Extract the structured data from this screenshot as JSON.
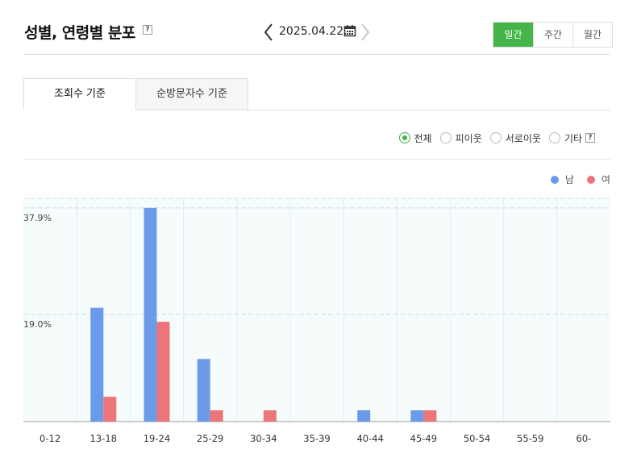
{
  "header": {
    "title": "성별, 연령별 분포",
    "help": "?",
    "date": "2025.04.22.",
    "periods": [
      {
        "label": "일간",
        "active": true
      },
      {
        "label": "주간",
        "active": false
      },
      {
        "label": "월간",
        "active": false
      }
    ]
  },
  "tabs": [
    {
      "label": "조회수 기준",
      "active": true
    },
    {
      "label": "순방문자수 기준",
      "active": false
    }
  ],
  "filters": {
    "options": [
      {
        "label": "전체",
        "selected": true
      },
      {
        "label": "피이웃",
        "selected": false
      },
      {
        "label": "서로이웃",
        "selected": false
      },
      {
        "label": "기타",
        "selected": false
      }
    ],
    "help": "?"
  },
  "colors": {
    "accent": "#45b549",
    "male": "#6b9be8",
    "female": "#ec7579",
    "grid": "#cfe3e3",
    "plot_bg": "#f6fbfc"
  },
  "chart_data": {
    "type": "bar",
    "categories": [
      "0-12",
      "13-18",
      "19-24",
      "25-29",
      "30-34",
      "35-39",
      "40-44",
      "45-49",
      "50-54",
      "55-59",
      "60-"
    ],
    "series": [
      {
        "name": "남",
        "values": [
          0,
          20.2,
          37.9,
          11.1,
          0,
          0,
          2.0,
          2.0,
          0,
          0,
          0
        ]
      },
      {
        "name": "여",
        "values": [
          0,
          4.4,
          17.7,
          2.0,
          2.0,
          0,
          0,
          2.0,
          0,
          0,
          0
        ]
      }
    ],
    "yticks": [
      {
        "value": 19.0,
        "label": "19.0%"
      },
      {
        "value": 37.9,
        "label": "37.9%"
      }
    ],
    "ylim": [
      0,
      39.6
    ],
    "grid": true,
    "legend": "top-right"
  }
}
